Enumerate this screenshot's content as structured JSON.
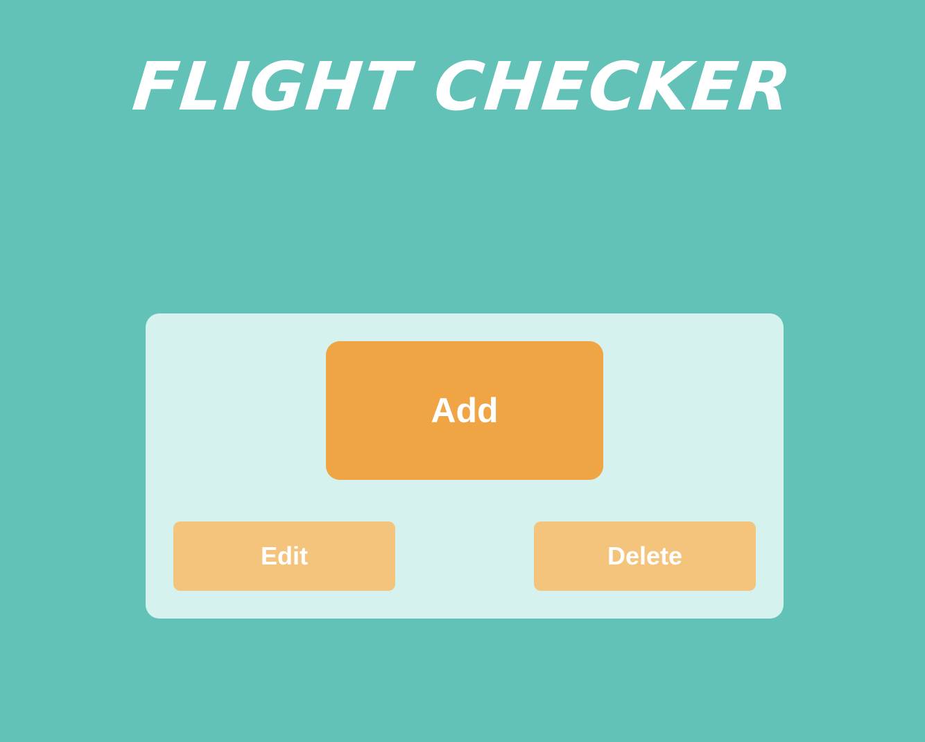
{
  "app": {
    "title": "FLIGHT CHECKER"
  },
  "actions": {
    "add_label": "Add",
    "edit_label": "Edit",
    "delete_label": "Delete"
  },
  "colors": {
    "background": "#62c2b7",
    "panel": "#d5f2ef",
    "primary_button": "#f0a544",
    "secondary_button": "#f5c47c",
    "text": "#ffffff"
  }
}
